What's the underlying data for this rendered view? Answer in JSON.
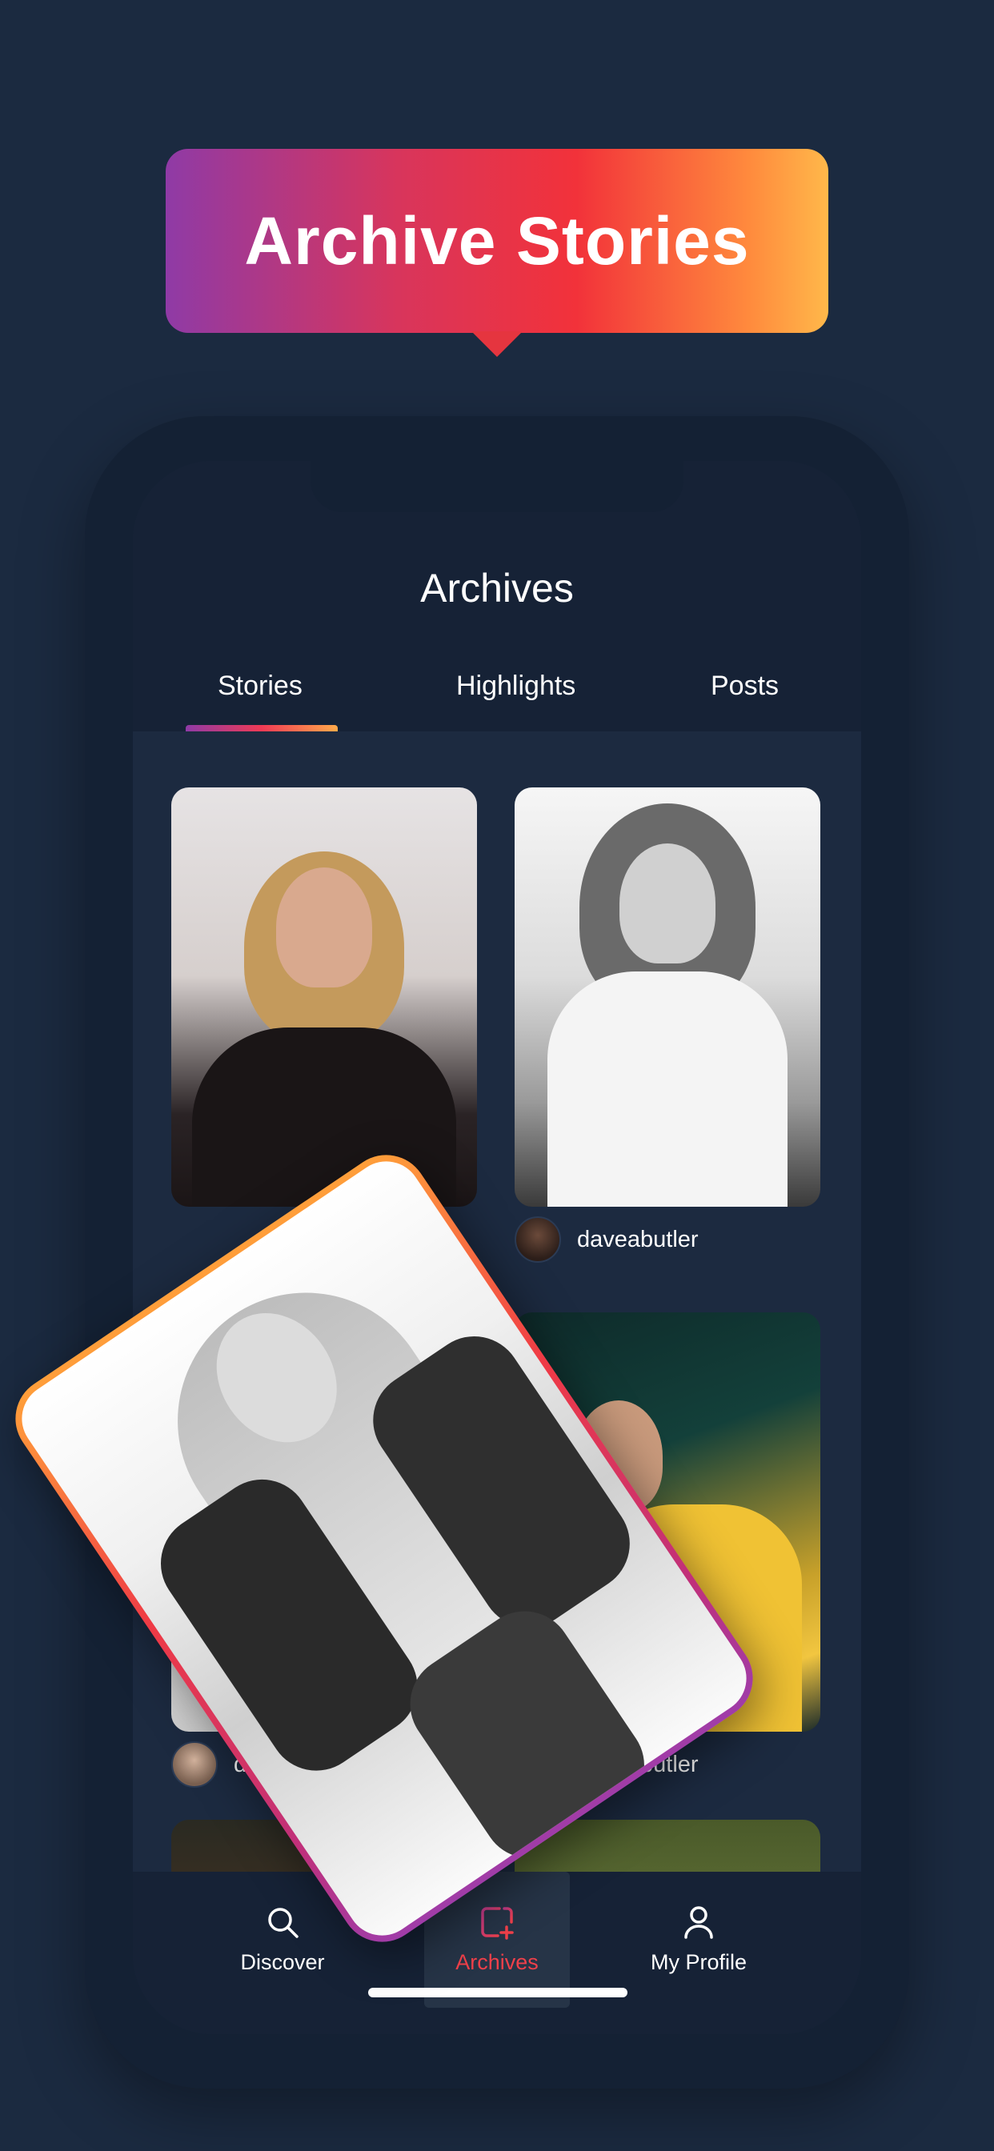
{
  "banner": {
    "title": "Archive Stories"
  },
  "app": {
    "title": "Archives",
    "tabs": [
      {
        "label": "Stories",
        "active": true
      },
      {
        "label": "Highlights",
        "active": false
      },
      {
        "label": "Posts",
        "active": false
      }
    ]
  },
  "stories": [
    {
      "username": ""
    },
    {
      "username": "daveabutler"
    },
    {
      "username": "davea"
    },
    {
      "username": "daveabutler"
    }
  ],
  "nav": {
    "items": [
      {
        "label": "Discover",
        "icon": "search-icon",
        "active": false
      },
      {
        "label": "Archives",
        "icon": "archive-add-icon",
        "active": true
      },
      {
        "label": "My Profile",
        "icon": "profile-icon",
        "active": false
      }
    ]
  },
  "colors": {
    "background": "#1b2a40",
    "accent": "#f0404a",
    "gradient_start": "#8f3aa6",
    "gradient_end": "#ffb84a"
  }
}
